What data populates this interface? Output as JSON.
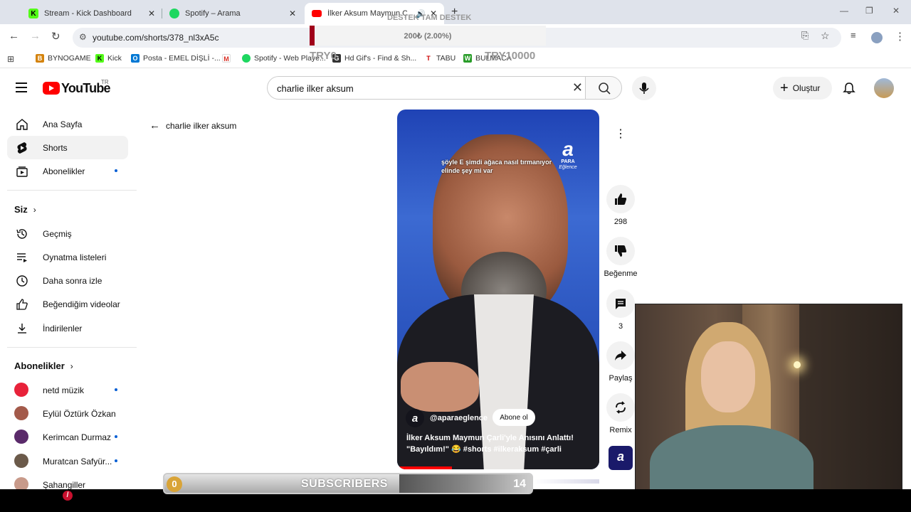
{
  "browser": {
    "tabs": [
      {
        "title": "Stream - Kick Dashboard",
        "icon": "kick-icon",
        "color": "#53fc18"
      },
      {
        "title": "Spotify – Arama",
        "icon": "spotify-icon",
        "color": "#1ed760"
      },
      {
        "title": "İlker Aksum Maymun Çarli",
        "icon": "youtube-icon",
        "color": "#ff0000"
      }
    ],
    "url": "youtube.com/shorts/378_nl3xA5c",
    "bookmarks": [
      "BYNOGAME",
      "Kick",
      "Posta - EMEL DİŞLİ -...",
      "",
      "Spotify - Web Playe...",
      "Hd Gif's - Find & Sh...",
      "TABU",
      "BULMACA"
    ]
  },
  "overlay": {
    "donation_title": "DESTEK TAM DESTEK",
    "donation_amount": "200₺ (2.00%)",
    "donation_progress": 0.02,
    "try_left": "TRY0",
    "try_right": "TRY10000"
  },
  "youtube": {
    "logo_text": "YouTube",
    "region": "TR",
    "search_query": "charlie ilker aksum",
    "create_label": "Oluştur",
    "sidebar": {
      "main": [
        {
          "label": "Ana Sayfa",
          "icon": "home-icon"
        },
        {
          "label": "Shorts",
          "icon": "shorts-icon"
        },
        {
          "label": "Abonelikler",
          "icon": "subscriptions-icon"
        }
      ],
      "you_title": "Siz",
      "you": [
        {
          "label": "Geçmiş",
          "icon": "history-icon"
        },
        {
          "label": "Oynatma listeleri",
          "icon": "playlist-icon"
        },
        {
          "label": "Daha sonra izle",
          "icon": "clock-icon"
        },
        {
          "label": "Beğendiğim videolar",
          "icon": "like-icon"
        },
        {
          "label": "İndirilenler",
          "icon": "download-icon"
        }
      ],
      "subs_title": "Abonelikler",
      "subs": [
        {
          "label": "netd müzik",
          "color": "#e8223a"
        },
        {
          "label": "Eylül Öztürk Özkan",
          "color": "#a35a4a"
        },
        {
          "label": "Kerimcan Durmaz",
          "color": "#5a2a6a"
        },
        {
          "label": "Muratcan Safyür...",
          "color": "#6b5a4a"
        },
        {
          "label": "Şahangiller",
          "color": "#c89a8a"
        }
      ]
    },
    "back_label": "charlie ilker aksum",
    "short": {
      "caption": "şöyle E şimdi ağaca nasıl tırmanıyor elinde şey mi var",
      "logo_a": "a",
      "logo_para": "PARA",
      "logo_eglence": "Eğlence",
      "channel": "@aparaeglence",
      "subscribe_label": "Abone ol",
      "title": "İlker Aksum Maymun Çarli'yle Anısını Anlattı! \"Bayıldım!\" 😂 #shorts #ilkeraksum #çarli",
      "progress": 0.27
    },
    "actions": {
      "likes": "298",
      "dislike_label": "Beğenme",
      "comments": "3",
      "share_label": "Paylaş",
      "remix_label": "Remix"
    }
  },
  "subs_goal": {
    "current": "0",
    "label": "SUBSCRIBERS",
    "target": "14"
  }
}
